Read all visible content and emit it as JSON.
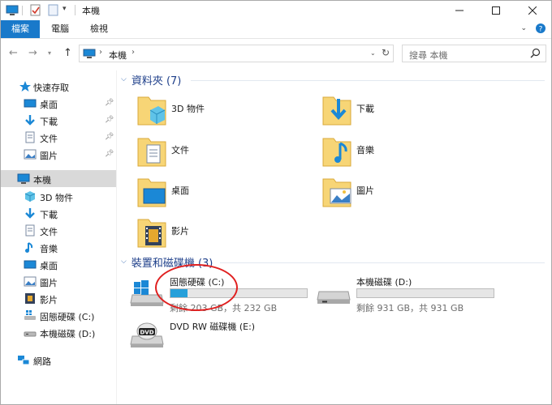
{
  "window": {
    "title": "本機"
  },
  "ribbon": {
    "tabs": [
      "檔案",
      "電腦",
      "檢視"
    ]
  },
  "address": {
    "path": "本機",
    "search_placeholder": "搜尋 本機"
  },
  "sidebar": {
    "quick_access": {
      "label": "快速存取",
      "items": [
        "桌面",
        "下載",
        "文件",
        "圖片"
      ]
    },
    "this_pc": {
      "label": "本機",
      "items": [
        "3D 物件",
        "下載",
        "文件",
        "音樂",
        "桌面",
        "圖片",
        "影片",
        "固態硬碟 (C:)",
        "本機磁碟 (D:)"
      ]
    },
    "network": {
      "label": "網路"
    }
  },
  "folders_group": {
    "title": "資料夾 (7)",
    "items": [
      "3D 物件",
      "下載",
      "文件",
      "音樂",
      "桌面",
      "圖片",
      "影片"
    ]
  },
  "devices_group": {
    "title": "裝置和磁碟機 (3)",
    "drives": [
      {
        "name": "固態硬碟 (C:)",
        "free_text": "剩餘 203 GB，共 232 GB",
        "used_fraction": 0.125
      },
      {
        "name": "本機磁碟 (D:)",
        "free_text": "剩餘 931 GB，共 931 GB",
        "used_fraction": 0.0
      },
      {
        "name": "DVD RW 磁碟機 (E:)"
      }
    ]
  },
  "colors": {
    "accent": "#1979ca",
    "group_title": "#1e3f8a",
    "drive_fill": "#26a0da",
    "annotation": "#e02020"
  }
}
